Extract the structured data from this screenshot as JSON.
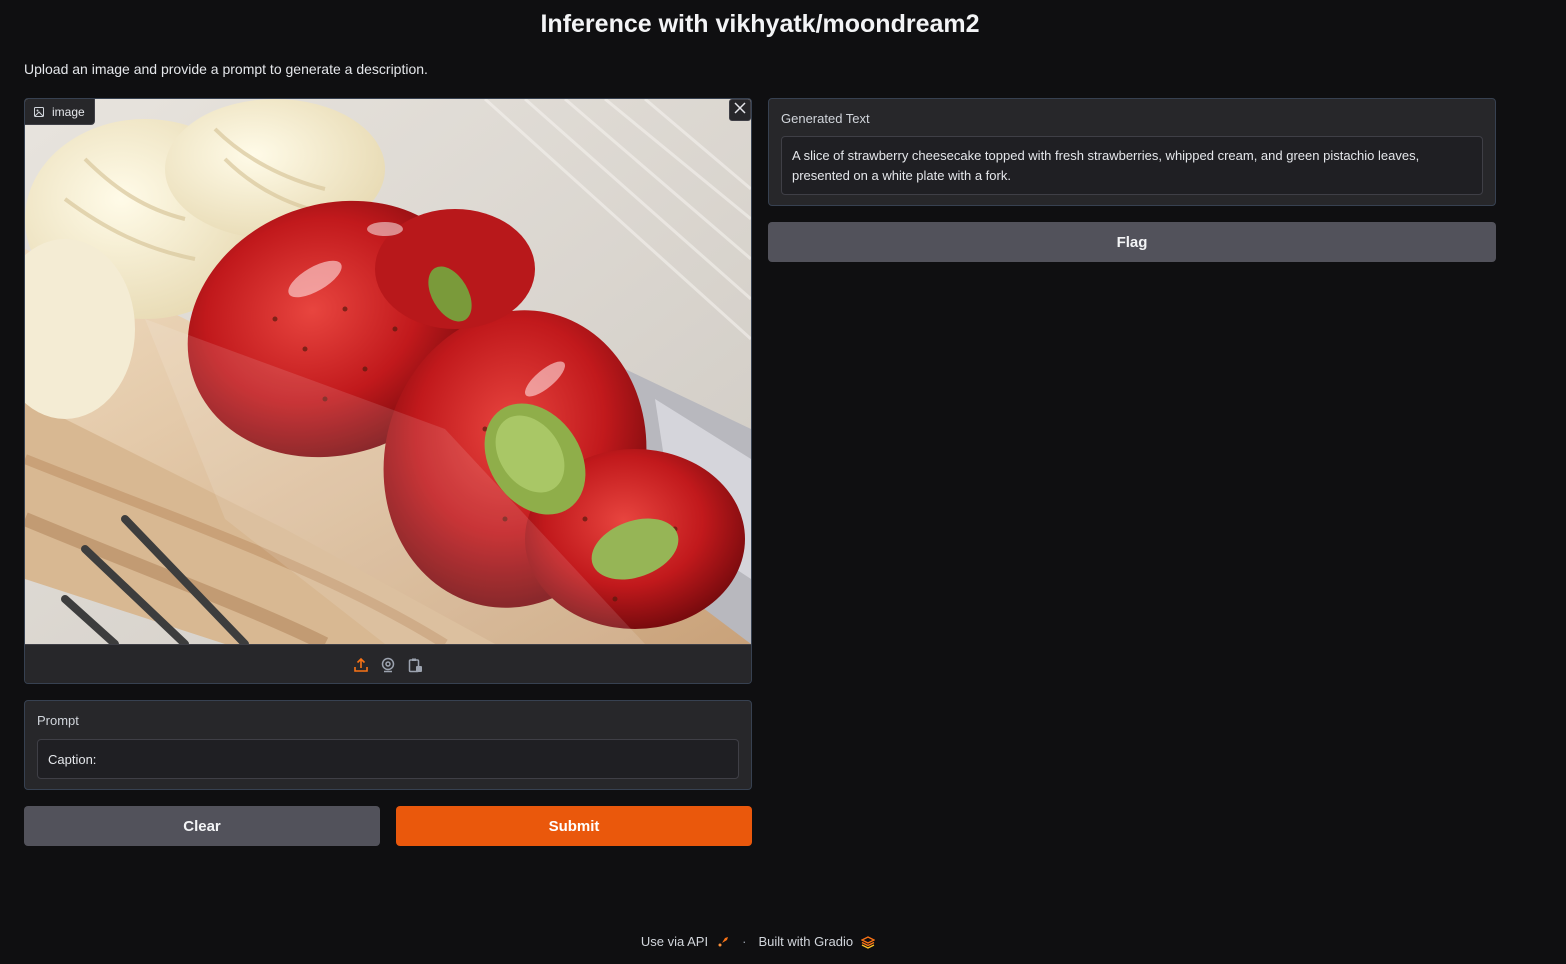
{
  "header": {
    "title": "Inference with vikhyatk/moondream2",
    "description": "Upload an image and provide a prompt to generate a description."
  },
  "image_input": {
    "label": "image",
    "image_subject": "strawberry-cheesecake-photo",
    "toolbar_icons": [
      "upload-icon",
      "webcam-icon",
      "clipboard-icon"
    ]
  },
  "prompt": {
    "label": "Prompt",
    "value": "Caption:"
  },
  "buttons": {
    "clear": "Clear",
    "submit": "Submit",
    "flag": "Flag"
  },
  "output": {
    "label": "Generated Text",
    "text": "A slice of strawberry cheesecake topped with fresh strawberries, whipped cream, and green pistachio leaves, presented on a white plate with a fork."
  },
  "footer": {
    "api_link": "Use via API",
    "separator": "·",
    "built_with": "Built with Gradio"
  },
  "colors": {
    "background": "#0f0f11",
    "panel": "#27272a",
    "primary_button": "#ea580c",
    "secondary_button": "#52525b",
    "accent_icon": "#f97316"
  }
}
